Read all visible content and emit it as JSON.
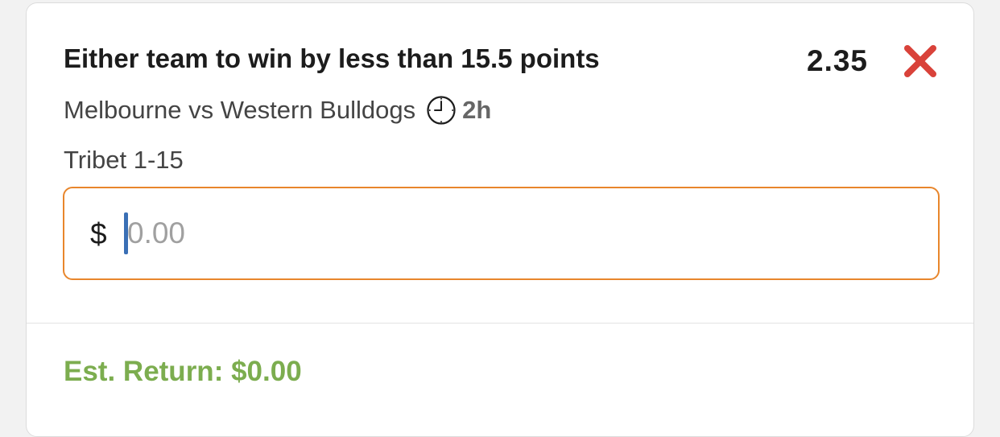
{
  "bet": {
    "selection": "Either team to win by less than 15.5 points",
    "odds": "2.35",
    "event": "Melbourne vs Western Bulldogs",
    "time_remaining": "2h",
    "market": "Tribet 1-15"
  },
  "stake": {
    "currency_symbol": "$",
    "placeholder": "0.00",
    "value": ""
  },
  "summary": {
    "estimated_return": "Est. Return: $0.00"
  },
  "icons": {
    "remove": "close-icon",
    "time": "clock-icon"
  },
  "colors": {
    "remove": "#d9423a",
    "input_border_focus": "#e8862c",
    "caret": "#3a6fb5",
    "return_text": "#7cad4f"
  }
}
